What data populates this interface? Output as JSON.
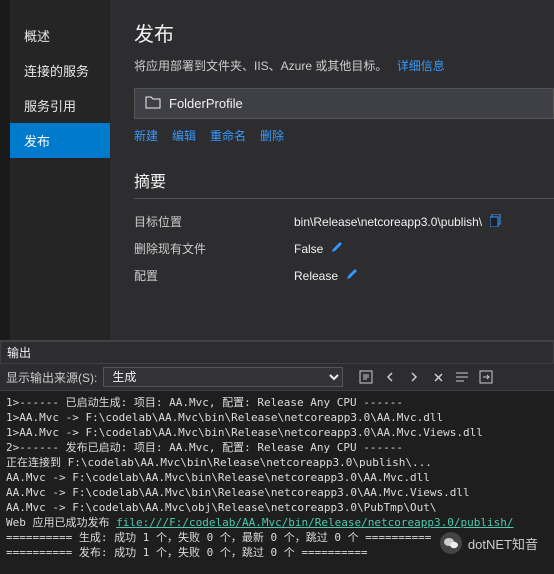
{
  "sidebar": {
    "items": [
      {
        "label": "概述"
      },
      {
        "label": "连接的服务"
      },
      {
        "label": "服务引用"
      },
      {
        "label": "发布"
      }
    ],
    "active_index": 3
  },
  "publish": {
    "title": "发布",
    "description": "将应用部署到文件夹、IIS、Azure 或其他目标。",
    "more_info": "详细信息",
    "profile_name": "FolderProfile",
    "actions": {
      "new": "新建",
      "edit": "编辑",
      "rename": "重命名",
      "delete": "删除"
    },
    "summary": {
      "title": "摘要",
      "rows": [
        {
          "label": "目标位置",
          "value": "bin\\Release\\netcoreapp3.0\\publish\\",
          "copy": true
        },
        {
          "label": "删除现有文件",
          "value": "False",
          "edit": true
        },
        {
          "label": "配置",
          "value": "Release",
          "edit": true
        }
      ]
    }
  },
  "output": {
    "panel_title": "输出",
    "source_label": "显示输出来源(S):",
    "source_value": "生成",
    "lines": [
      "1>------ 已启动生成: 项目: AA.Mvc, 配置: Release Any CPU ------",
      "1>AA.Mvc -> F:\\codelab\\AA.Mvc\\bin\\Release\\netcoreapp3.0\\AA.Mvc.dll",
      "1>AA.Mvc -> F:\\codelab\\AA.Mvc\\bin\\Release\\netcoreapp3.0\\AA.Mvc.Views.dll",
      "2>------ 发布已启动: 项目: AA.Mvc, 配置: Release Any CPU ------",
      "正在连接到 F:\\codelab\\AA.Mvc\\bin\\Release\\netcoreapp3.0\\publish\\...",
      "AA.Mvc -> F:\\codelab\\AA.Mvc\\bin\\Release\\netcoreapp3.0\\AA.Mvc.dll",
      "AA.Mvc -> F:\\codelab\\AA.Mvc\\bin\\Release\\netcoreapp3.0\\AA.Mvc.Views.dll",
      "AA.Mvc -> F:\\codelab\\AA.Mvc\\obj\\Release\\netcoreapp3.0\\PubTmp\\Out\\"
    ],
    "publish_success_prefix": "Web 应用已成功发布 ",
    "publish_success_link": "file:///F:/codelab/AA.Mvc/bin/Release/netcoreapp3.0/publish/",
    "footer1": "========== 生成: 成功 1 个，失败 0 个，最新 0 个，跳过 0 个 ==========",
    "footer2": "========== 发布: 成功 1 个，失败 0 个，跳过 0 个 =========="
  },
  "watermark": "dotNET知音"
}
